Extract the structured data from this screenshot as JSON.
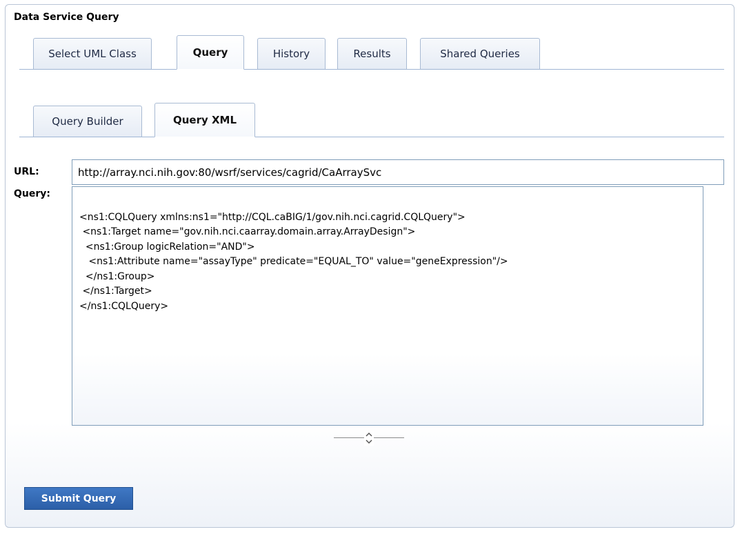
{
  "panel": {
    "title": "Data Service Query"
  },
  "main_tabs": [
    {
      "label": "Select UML Class",
      "active": false
    },
    {
      "label": "Query",
      "active": true
    },
    {
      "label": "History",
      "active": false
    },
    {
      "label": "Results",
      "active": false
    },
    {
      "label": "Shared Queries",
      "active": false
    }
  ],
  "sub_tabs": [
    {
      "label": "Query Builder",
      "active": false
    },
    {
      "label": "Query XML",
      "active": true
    }
  ],
  "url": {
    "label": "URL:",
    "value": "http://array.nci.nih.gov:80/wsrf/services/cagrid/CaArraySvc"
  },
  "query": {
    "label": "Query:",
    "lines": [
      "<ns1:CQLQuery xmlns:ns1=\"http://CQL.caBIG/1/gov.nih.nci.cagrid.CQLQuery\">",
      " <ns1:Target name=\"gov.nih.nci.caarray.domain.array.ArrayDesign\">",
      "  <ns1:Group logicRelation=\"AND\">",
      "   <ns1:Attribute name=\"assayType\" predicate=\"EQUAL_TO\" value=\"geneExpression\"/>",
      "  </ns1:Group>",
      " </ns1:Target>",
      "</ns1:CQLQuery>"
    ]
  },
  "resize_handle": {
    "icon": "resize-grip-icon"
  },
  "submit": {
    "label": "Submit Query"
  }
}
